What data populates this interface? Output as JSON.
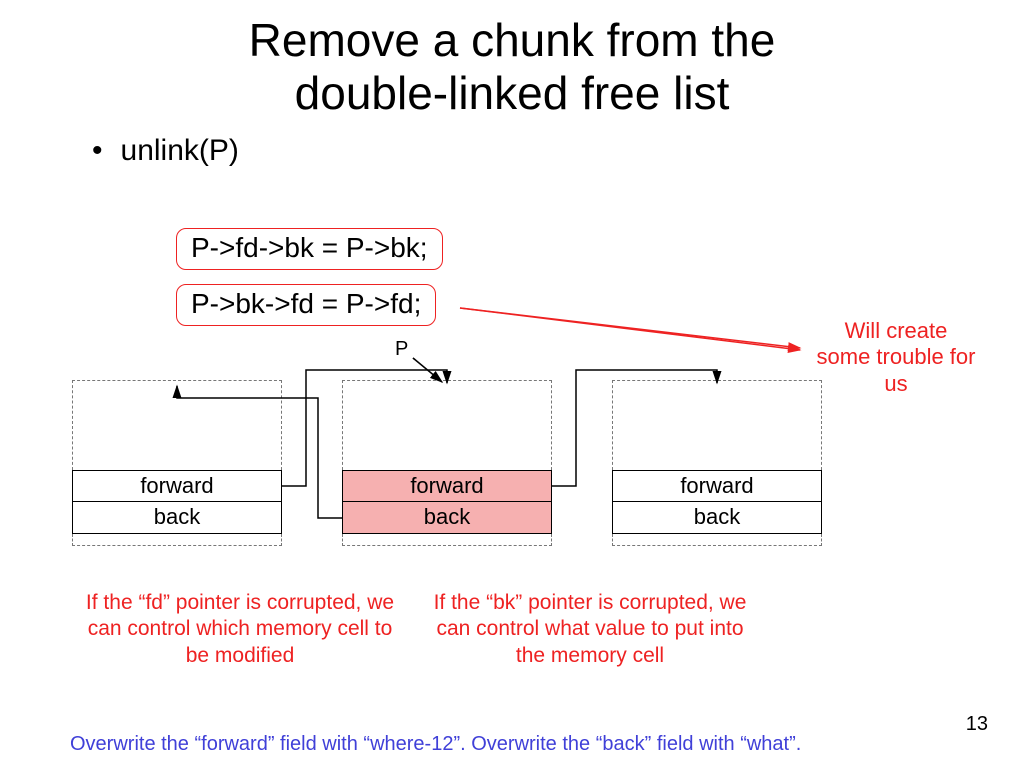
{
  "title_line1": "Remove a chunk from the",
  "title_line2": "double-linked free list",
  "bullet": "unlink(P)",
  "code1": "P->fd->bk = P->bk;",
  "code2": "P->bk->fd = P->fd;",
  "p_label": "P",
  "trouble": "Will create some trouble for us",
  "chunks": {
    "left": {
      "fwd": "forward",
      "bck": "back"
    },
    "mid": {
      "fwd": "forward",
      "bck": "back"
    },
    "right": {
      "fwd": "forward",
      "bck": "back"
    }
  },
  "caption_left": "If the “fd” pointer is corrupted, we can control which memory cell to be modified",
  "caption_right": "If the “bk” pointer is corrupted, we can control what value to put into the memory cell",
  "overwrite": "Overwrite the “forward” field with “where-12”. Overwrite the “back” field with “what”.",
  "page_num": "13"
}
